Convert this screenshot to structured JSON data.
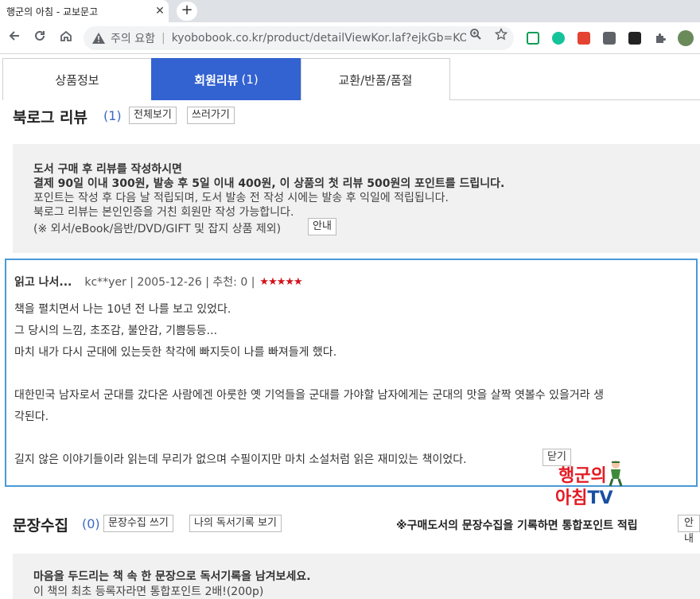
{
  "browser": {
    "tab_title": "행군의 아침 - 교보문고",
    "tab_close": "✕",
    "new_tab": "+",
    "security_label": "주의 요함",
    "url": "kyobobook.co.kr/product/detailViewKor.laf?ejkGb=KO..."
  },
  "tabs": [
    {
      "label": "상품정보",
      "count": ""
    },
    {
      "label": "회원리뷰",
      "count": "(1)"
    },
    {
      "label": "교환/반품/품절",
      "count": ""
    }
  ],
  "booklog": {
    "heading": "북로그 리뷰",
    "count": "(1)",
    "view_all": "전체보기",
    "write": "쓰러가기"
  },
  "notice": {
    "line1": "도서 구매 후 리뷰를 작성하시면",
    "line2": "결제 90일 이내 300원, 발송 후 5일 이내 400원, 이 상품의 첫 리뷰 500원의 포인트를 드립니다.",
    "line3": "포인트는 작성 후 다음 날 적립되며, 도서 발송 전 작성 시에는 발송 후 익일에 적립됩니다.",
    "line4": "북로그 리뷰는 본인인증을 거친 회원만 작성 가능합니다.",
    "line5": "(※ 외서/eBook/음반/DVD/GIFT 및 잡지 상품 제외)",
    "guide": "안내"
  },
  "review": {
    "title": "읽고 나서...",
    "meta": "kc**yer | 2005-12-26 | 추천: 0 |",
    "rating": 5,
    "stars": "★★★★★",
    "lines": [
      "책을 펼치면서 나는 10년 전 나를 보고 있었다.",
      "그 당시의 느낌, 초조감, 불안감, 기쁨등등...",
      "마치 내가 다시 군대에 있는듯한 착각에 빠지듯이 나를 빠져들게 했다.",
      "대한민국 남자로서 군대를 갔다온 사람에겐 아룻한 옛 기억들을 군대를 가야할 남자에게는 군대의 맛을 살짝 엿볼수 있을거라 생",
      "각된다.",
      "길지 않은 이야기들이라 읽는데 무리가 없으며 수필이지만 마치 소설처럼 읽은 재미있는 책이었다."
    ],
    "close": "닫기"
  },
  "watermark": {
    "line1": "행군의",
    "line2a": "아침",
    "line2b": "TV"
  },
  "sentences": {
    "heading": "문장수집",
    "count": "(0)",
    "write": "문장수집 쓰기",
    "my_records": "나의 독서기록 보기",
    "right_note": "※구매도서의 문장수집을 기록하면 통합포인트 적립",
    "guide": "안내"
  },
  "notice2": {
    "line1": "마음을 두드리는 책 속 한 문장으로 독서기록을 남겨보세요.",
    "line2": "이 책의 최초 등록자라면 통합포인트 2배!(200p)"
  },
  "colors": {
    "accent_blue": "#3362d1",
    "review_border": "#4a9ad8",
    "star_red": "#d0121b"
  }
}
